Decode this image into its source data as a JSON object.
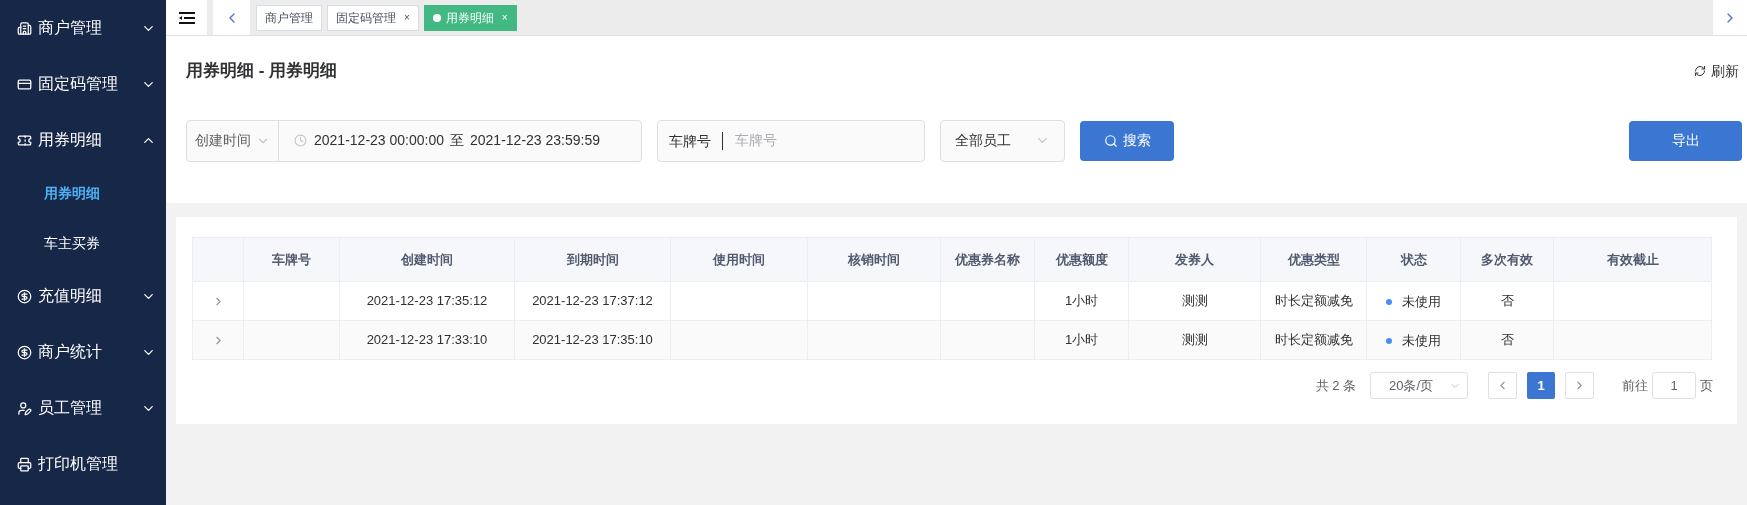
{
  "sidebar": {
    "items": [
      {
        "label": "商户管理",
        "expanded": false
      },
      {
        "label": "固定码管理",
        "expanded": false
      },
      {
        "label": "用券明细",
        "expanded": true,
        "children": [
          {
            "label": "用券明细",
            "selected": true
          },
          {
            "label": "车主买券",
            "selected": false
          }
        ]
      },
      {
        "label": "充值明细",
        "expanded": false
      },
      {
        "label": "商户统计",
        "expanded": false
      },
      {
        "label": "员工管理",
        "expanded": false
      },
      {
        "label": "打印机管理"
      }
    ]
  },
  "tabs": [
    {
      "label": "商户管理",
      "closable": false,
      "selected": false
    },
    {
      "label": "固定码管理",
      "closable": true,
      "selected": false
    },
    {
      "label": "用券明细",
      "closable": true,
      "selected": true
    }
  ],
  "tab_close": "×",
  "page_title": "用券明细 - 用券明细",
  "refresh": "刷新",
  "filters": {
    "date_type": "创建时间",
    "date_start": "2021-12-23 00:00:00",
    "date_sep": "至",
    "date_end": "2021-12-23 23:59:59",
    "plate_label": "车牌号",
    "plate_placeholder": "车牌号",
    "employee": "全部员工",
    "search": "搜索",
    "export": "导出"
  },
  "table": {
    "columns": [
      "车牌号",
      "创建时间",
      "到期时间",
      "使用时间",
      "核销时间",
      "优惠券名称",
      "优惠额度",
      "发券人",
      "优惠类型",
      "状态",
      "多次有效",
      "有效截止"
    ],
    "rows": [
      {
        "cells": [
          "",
          "2021-12-23 17:35:12",
          "2021-12-23 17:37:12",
          "",
          "",
          "",
          "1小时",
          "测测",
          "时长定额减免",
          "未使用",
          "否",
          ""
        ]
      },
      {
        "cells": [
          "",
          "2021-12-23 17:33:10",
          "2021-12-23 17:35:10",
          "",
          "",
          "",
          "1小时",
          "测测",
          "时长定额减免",
          "未使用",
          "否",
          ""
        ]
      }
    ]
  },
  "pagination": {
    "total": "共 2 条",
    "page_size": "20条/页",
    "pages": [
      {
        "label": "1",
        "selected": true
      }
    ],
    "goto_label": "前往",
    "goto_value": "1",
    "goto_suffix": "页"
  }
}
